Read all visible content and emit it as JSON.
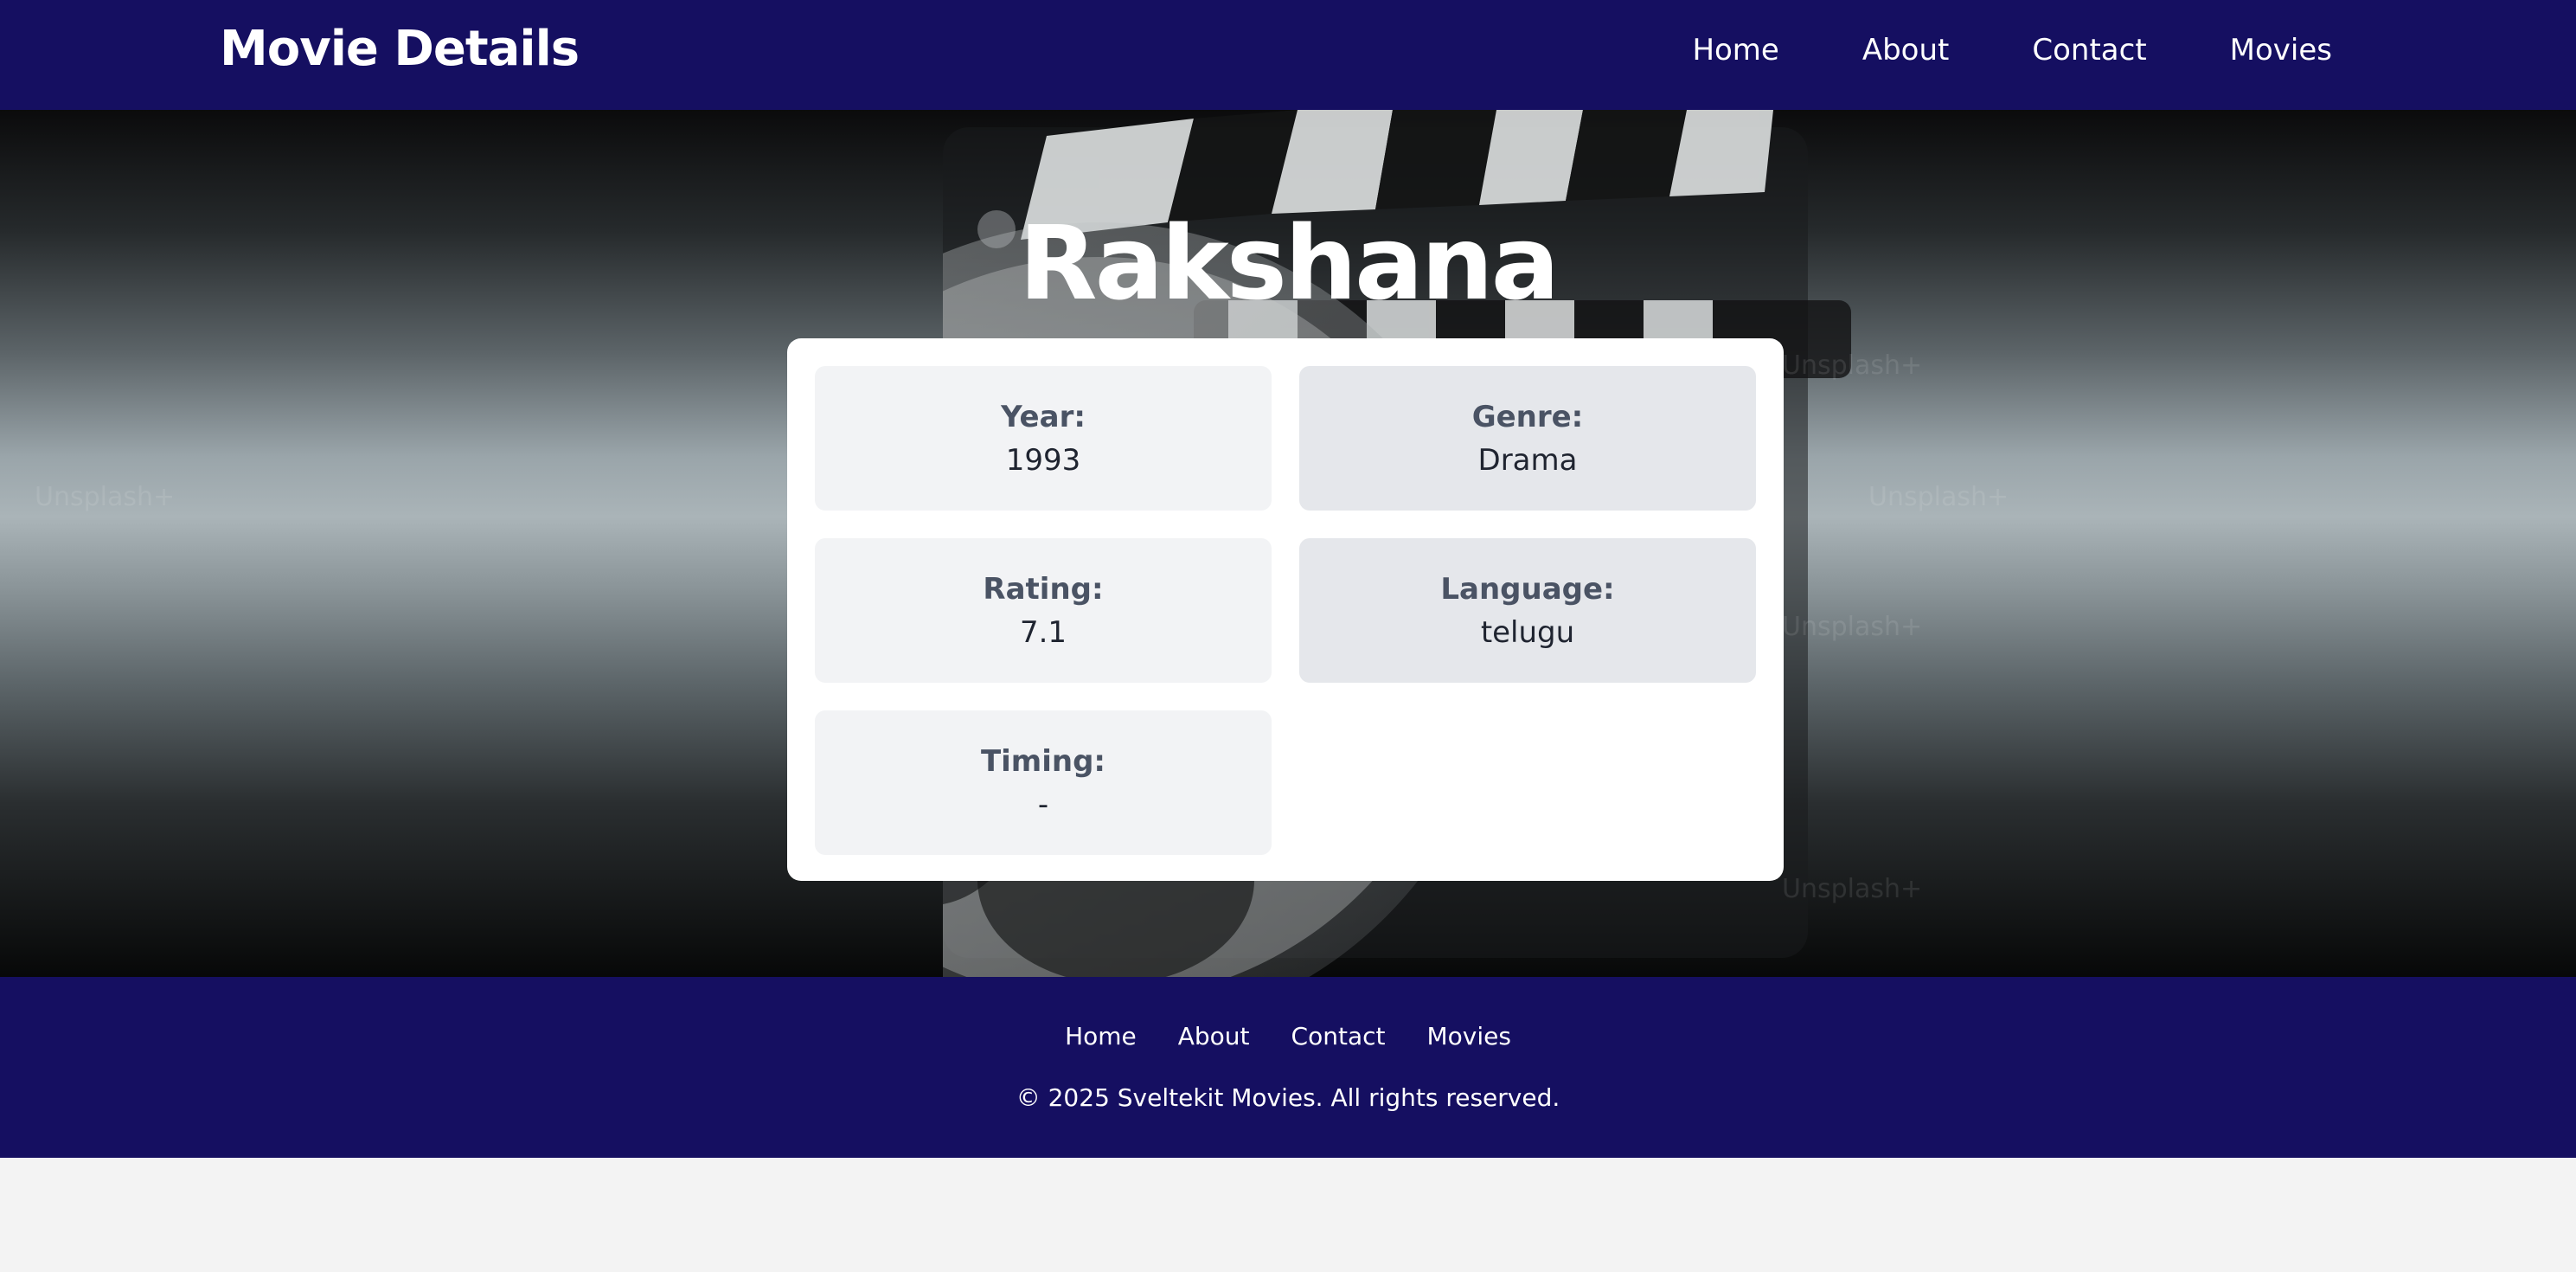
{
  "header": {
    "brand": "Movie Details",
    "nav": [
      "Home",
      "About",
      "Contact",
      "Movies"
    ]
  },
  "hero": {
    "background_icon": "film-clapperboard-and-reel-image",
    "watermark_text": "Unsplash+"
  },
  "movie": {
    "title": "Rakshana",
    "fields": [
      {
        "label": "Year:",
        "value": "1993"
      },
      {
        "label": "Genre:",
        "value": "Drama"
      },
      {
        "label": "Rating:",
        "value": "7.1"
      },
      {
        "label": "Language:",
        "value": "telugu"
      },
      {
        "label": "Timing:",
        "value": "-"
      }
    ]
  },
  "footer": {
    "nav": [
      "Home",
      "About",
      "Contact",
      "Movies"
    ],
    "copyright": "© 2025 Sveltekit Movies. All rights reserved."
  },
  "colors": {
    "nav_bg": "#150f61",
    "card_bg": "#ffffff",
    "cell_light": "#f2f3f5",
    "cell_dark": "#e5e7eb"
  }
}
